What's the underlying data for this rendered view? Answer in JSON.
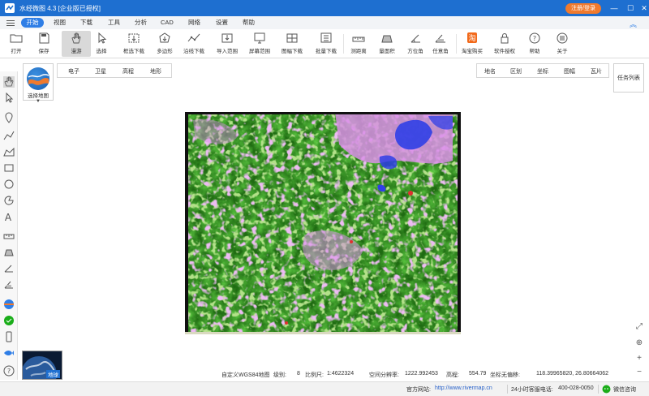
{
  "window": {
    "title": "水经微图 4.3 [企业版已授权]",
    "login_label": "注册/登录"
  },
  "menu": {
    "items": [
      "开始",
      "视图",
      "下载",
      "工具",
      "分析",
      "CAD",
      "网络",
      "设置",
      "帮助"
    ],
    "active": "开始"
  },
  "toolbar": {
    "items": [
      {
        "label": "打开",
        "icon": "folder-icon"
      },
      {
        "label": "保存",
        "icon": "save-icon"
      },
      {
        "label": "漫游",
        "icon": "hand-icon"
      },
      {
        "label": "选择",
        "icon": "cursor-icon"
      },
      {
        "label": "框选下载",
        "icon": "box-download-icon"
      },
      {
        "label": "多边形",
        "icon": "polygon-icon"
      },
      {
        "label": "沿线下载",
        "icon": "line-download-icon"
      },
      {
        "label": "导入范围",
        "icon": "import-icon"
      },
      {
        "label": "屏幕范围",
        "icon": "screen-icon"
      },
      {
        "label": "图幅下载",
        "icon": "sheet-icon"
      },
      {
        "label": "批量下载",
        "icon": "batch-icon"
      },
      {
        "label": "测距离",
        "icon": "ruler-icon"
      },
      {
        "label": "量面积",
        "icon": "area-icon"
      },
      {
        "label": "方位角",
        "icon": "azimuth-icon"
      },
      {
        "label": "任意角",
        "icon": "angle-icon"
      },
      {
        "label": "淘宝购买",
        "icon": "taobao-icon"
      },
      {
        "label": "软件授权",
        "icon": "lock-icon"
      },
      {
        "label": "帮助",
        "icon": "help-icon"
      },
      {
        "label": "关于",
        "icon": "about-icon"
      }
    ]
  },
  "map_chooser": {
    "label": "选择地图"
  },
  "map_tabs": [
    "电子",
    "卫星",
    "高程",
    "地形"
  ],
  "layers": [
    "地名",
    "区划",
    "坐标",
    "图幅",
    "瓦片"
  ],
  "task_list": "任务列表",
  "thumbnail": {
    "label": "地球"
  },
  "status": {
    "map_name": "自定义WGS84地图",
    "level_label": "级别:",
    "level": "8",
    "scale_label": "比例尺:",
    "scale": "1:4622324",
    "resolution_label": "空间分辨率:",
    "resolution": "1222.992453",
    "elevation_label": "高程:",
    "elevation": "554.79",
    "offset_label": "坐标无偏移:",
    "coords": "118.39965820, 26.80664062"
  },
  "bottom": {
    "site_label": "官方网站:",
    "site_url": "http://www.rivermap.cn",
    "phone_label": "24小时客服电话:",
    "phone": "400-028-0050",
    "wechat": "微信咨询"
  },
  "colors": {
    "title_bar": "#1e6fd0",
    "accent": "#2f7ee6",
    "login": "#f07a2e",
    "vegetation": "#2e7d1c",
    "urban": "#d77ee0",
    "water": "#2f3fe6"
  }
}
